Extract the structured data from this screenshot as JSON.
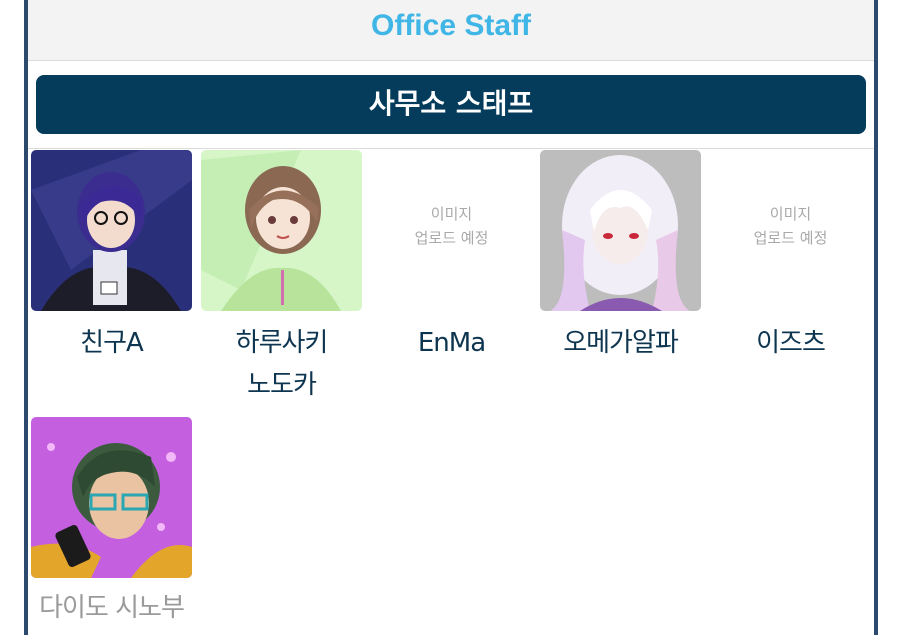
{
  "header": {
    "title": "Office Staff"
  },
  "section": {
    "title": "사무소 스태프"
  },
  "placeholder_text": {
    "line1": "이미지",
    "line2": "업로드 예정"
  },
  "staff": [
    {
      "name": "친구A",
      "has_image": true
    },
    {
      "name_line1": "하루사키",
      "name_line2": "노도카",
      "has_image": true
    },
    {
      "name": "EnMa",
      "has_image": false
    },
    {
      "name": "오메가알파",
      "has_image": true
    },
    {
      "name": "이즈츠",
      "has_image": false
    },
    {
      "name": "다이도 시노부",
      "has_image": true,
      "muted": true
    }
  ],
  "colors": {
    "header_title": "#3fb6e6",
    "banner_bg": "#053c5b",
    "frame_border": "#2d4a6e",
    "name_text": "#0d3550",
    "placeholder_text": "#a9a9a9",
    "muted_name": "#9a9a9a"
  },
  "icons": {
    "staff_1": "character-portrait-blue-hair",
    "staff_2": "character-portrait-brown-hair",
    "staff_4": "character-portrait-white-hair",
    "staff_6": "character-portrait-green-hair"
  }
}
